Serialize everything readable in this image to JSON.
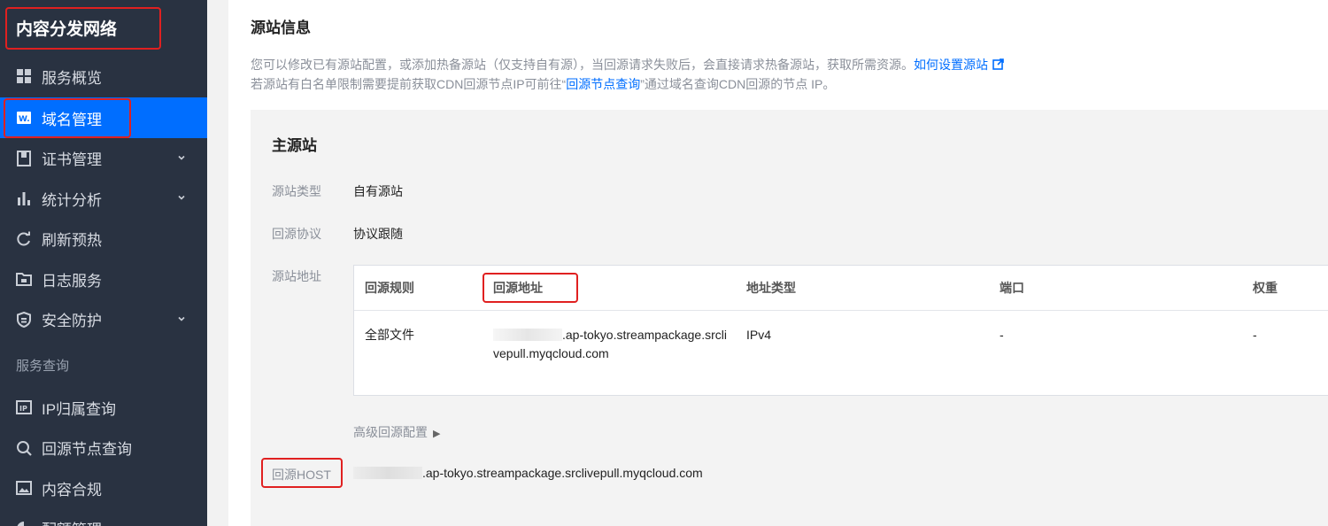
{
  "app": {
    "title": "内容分发网络"
  },
  "sidebar": {
    "items": [
      {
        "label": "服务概览",
        "icon": "grid-icon"
      },
      {
        "label": "域名管理",
        "icon": "domain-icon",
        "active": true
      },
      {
        "label": "证书管理",
        "icon": "certificate-icon",
        "expandable": true
      },
      {
        "label": "统计分析",
        "icon": "bar-chart-icon",
        "expandable": true
      },
      {
        "label": "刷新预热",
        "icon": "refresh-icon"
      },
      {
        "label": "日志服务",
        "icon": "log-folder-icon"
      },
      {
        "label": "安全防护",
        "icon": "shield-icon",
        "expandable": true
      }
    ],
    "section_query": "服务查询",
    "query_items": [
      {
        "label": "IP归属查询",
        "icon": "ip-icon"
      },
      {
        "label": "回源节点查询",
        "icon": "search-icon"
      },
      {
        "label": "内容合规",
        "icon": "image-icon"
      },
      {
        "label": "配额管理",
        "icon": "pie-icon",
        "expandable": true
      }
    ]
  },
  "main": {
    "section_title": "源站信息",
    "desc_line1": "您可以修改已有源站配置，或添加热备源站（仅支持自有源），当回源请求失败后，会直接请求热备源站，获取所需资源。",
    "desc_link1": "如何设置源站",
    "desc_line2_pre": "若源站有白名单限制需要提前获取CDN回源节点IP可前往“",
    "desc_link2": "回源节点查询",
    "desc_line2_post": "”通过域名查询CDN回源的节点 IP。",
    "primary": {
      "title": "主源站",
      "origin_type_label": "源站类型",
      "origin_type_value": "自有源站",
      "protocol_label": "回源协议",
      "protocol_value": "协议跟随",
      "address_label": "源站地址",
      "table": {
        "headers": [
          "回源规则",
          "回源地址",
          "地址类型",
          "端口",
          "权重"
        ],
        "rows": [
          {
            "rule": "全部文件",
            "address_suffix": ".ap-tokyo.streampackage.srclivepull.myqcloud.com",
            "type": "IPv4",
            "port": "-",
            "weight": "-"
          }
        ]
      },
      "advanced_link": "高级回源配置",
      "host_label": "回源HOST",
      "host_value_suffix": ".ap-tokyo.streampackage.srclivepull.myqcloud.com"
    }
  },
  "colors": {
    "sidebar_bg": "#293241",
    "accent": "#006eff",
    "annotation_red": "#e02020"
  }
}
